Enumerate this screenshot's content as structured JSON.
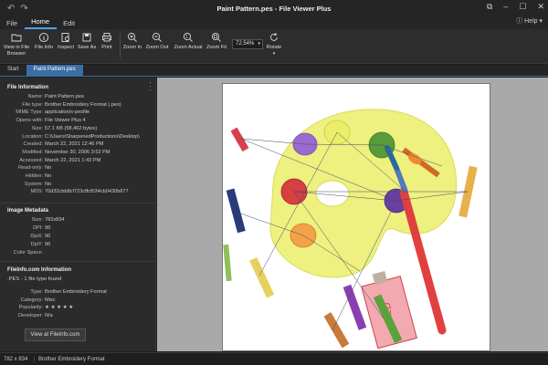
{
  "window": {
    "title": "Paint Pattern.pes - File Viewer Plus",
    "help": "Help"
  },
  "menu": {
    "file": "File",
    "home": "Home",
    "edit": "Edit"
  },
  "ribbon": {
    "view_in_browser": "View in File\nBrowser",
    "file_info": "File Info",
    "inspect": "Inspect",
    "save_as": "Save As",
    "print": "Print",
    "zoom_in": "Zoom In",
    "zoom_out": "Zoom Out",
    "zoom_actual": "Zoom Actual",
    "zoom_fit": "Zoom Fit",
    "zoom_level": "72.54%",
    "rotate": "Rotate"
  },
  "tabs": {
    "start": "Start",
    "file": "Paint Pattern.pes"
  },
  "file_information": {
    "heading": "File Information",
    "rows": [
      {
        "k": "Name:",
        "v": "Paint Pattern.pes"
      },
      {
        "k": "File type:",
        "v": "Brother Embroidery Format (.pes)"
      },
      {
        "k": "MIME Type:",
        "v": "application/x-pesfile"
      },
      {
        "k": "Opens with:",
        "v": "File Viewer Plus 4"
      },
      {
        "k": "Size:",
        "v": "57.1 KB (58,462 bytes)"
      },
      {
        "k": "Location:",
        "v": "C:\\Users\\SharpenedProductions\\Desktop\\"
      },
      {
        "k": "Created:",
        "v": "March 22, 2021 12:46 PM"
      },
      {
        "k": "Modified:",
        "v": "November 30, 2006 3:52 PM"
      },
      {
        "k": "Accessed:",
        "v": "March 22, 2021 1:43 PM"
      },
      {
        "k": "Read-only:",
        "v": "No"
      },
      {
        "k": "Hidden:",
        "v": "No"
      },
      {
        "k": "System:",
        "v": "No"
      },
      {
        "k": "MD5:",
        "v": "70d32cbb8cf723cffcf034cb0430b677"
      }
    ]
  },
  "image_metadata": {
    "heading": "Image Metadata",
    "rows": [
      {
        "k": "Size:",
        "v": "782x834"
      },
      {
        "k": "DPI:",
        "v": "96"
      },
      {
        "k": "DpiX:",
        "v": "96"
      },
      {
        "k": "DpiY:",
        "v": "96"
      },
      {
        "k": "Color Space:",
        "v": ""
      }
    ]
  },
  "fileinfo": {
    "heading": "FileInfo.com Information",
    "subtitle": ".PES - 1 file type found",
    "rows": [
      {
        "k": "Type:",
        "v": "Brother Embroidery Format"
      },
      {
        "k": "Category:",
        "v": "Misc"
      },
      {
        "k": "Popularity:",
        "v": "★ ★ ★ ★ ★"
      },
      {
        "k": "Developer:",
        "v": "N/a"
      }
    ],
    "button": "View at FileInfo.com"
  },
  "status": {
    "dimensions": "782 x 834",
    "format": "Brother Embroidery Format"
  },
  "colors": {
    "accent": "#3b6ea5",
    "palette": "#e8ec7a",
    "red": "#e04040",
    "purple": "#8a3fb0",
    "blue": "#3a5a9a",
    "orange": "#f09a40",
    "green": "#5aa23a"
  }
}
